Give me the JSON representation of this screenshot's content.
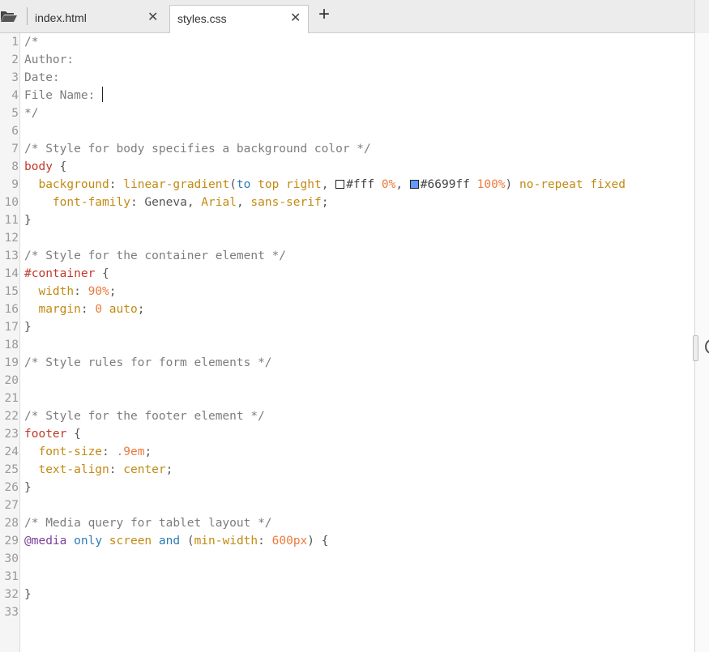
{
  "tabs": [
    {
      "label": "index.html",
      "active": false
    },
    {
      "label": "styles.css",
      "active": true
    }
  ],
  "icons": {
    "folder": "folder-open-icon",
    "close": "close-icon",
    "add": "plus-icon"
  },
  "colors": {
    "swatch1": "#ffffff",
    "swatch2": "#6699ff"
  },
  "lines": [
    {
      "n": "1",
      "t": "/*"
    },
    {
      "n": "2",
      "t": "Author:"
    },
    {
      "n": "3",
      "t": "Date:"
    },
    {
      "n": "4",
      "t": "File Name: "
    },
    {
      "n": "5",
      "t": "*/"
    },
    {
      "n": "6",
      "t": ""
    },
    {
      "n": "7",
      "t": "/* Style for body specifies a background color */"
    },
    {
      "n": "8",
      "t": "body {"
    },
    {
      "n": "9",
      "t": "  background: linear-gradient(to top right, #fff 0%, #6699ff 100%) no-repeat fixed"
    },
    {
      "n": "10",
      "t": "    font-family: Geneva, Arial, sans-serif;"
    },
    {
      "n": "11",
      "t": "}"
    },
    {
      "n": "12",
      "t": ""
    },
    {
      "n": "13",
      "t": "/* Style for the container element */"
    },
    {
      "n": "14",
      "t": "#container {"
    },
    {
      "n": "15",
      "t": "  width: 90%;"
    },
    {
      "n": "16",
      "t": "  margin: 0 auto;"
    },
    {
      "n": "17",
      "t": "}"
    },
    {
      "n": "18",
      "t": ""
    },
    {
      "n": "19",
      "t": "/* Style rules for form elements */"
    },
    {
      "n": "20",
      "t": ""
    },
    {
      "n": "21",
      "t": ""
    },
    {
      "n": "22",
      "t": "/* Style for the footer element */"
    },
    {
      "n": "23",
      "t": "footer {"
    },
    {
      "n": "24",
      "t": "  font-size: .9em;"
    },
    {
      "n": "25",
      "t": "  text-align: center;"
    },
    {
      "n": "26",
      "t": "}"
    },
    {
      "n": "27",
      "t": ""
    },
    {
      "n": "28",
      "t": "/* Media query for tablet layout */"
    },
    {
      "n": "29",
      "t": "@media only screen and (min-width: 600px) {"
    },
    {
      "n": "30",
      "t": ""
    },
    {
      "n": "31",
      "t": ""
    },
    {
      "n": "32",
      "t": "}"
    },
    {
      "n": "33",
      "t": ""
    }
  ]
}
